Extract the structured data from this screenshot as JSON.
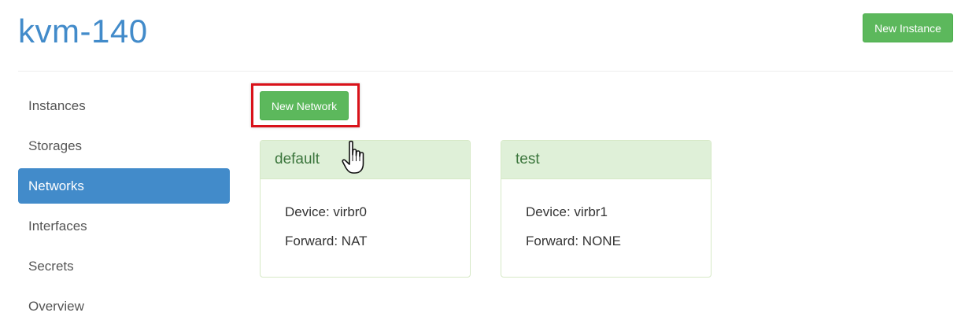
{
  "header": {
    "host_name": "kvm-140",
    "new_instance_label": "New Instance"
  },
  "sidebar": {
    "items": [
      {
        "label": "Instances",
        "active": false
      },
      {
        "label": "Storages",
        "active": false
      },
      {
        "label": "Networks",
        "active": true
      },
      {
        "label": "Interfaces",
        "active": false
      },
      {
        "label": "Secrets",
        "active": false
      },
      {
        "label": "Overview",
        "active": false
      }
    ]
  },
  "main": {
    "new_network_label": "New Network",
    "networks": [
      {
        "name": "default",
        "device": "Device: virbr0",
        "forward": "Forward: NAT"
      },
      {
        "name": "test",
        "device": "Device: virbr1",
        "forward": "Forward: NONE"
      }
    ]
  },
  "colors": {
    "brand": "#428bca",
    "success": "#5cb85c",
    "panel_heading_bg": "#dff0d8",
    "panel_heading_text": "#3c763d",
    "highlight": "#d9121a"
  },
  "icons": {
    "cursor": "hand-pointer-icon"
  }
}
